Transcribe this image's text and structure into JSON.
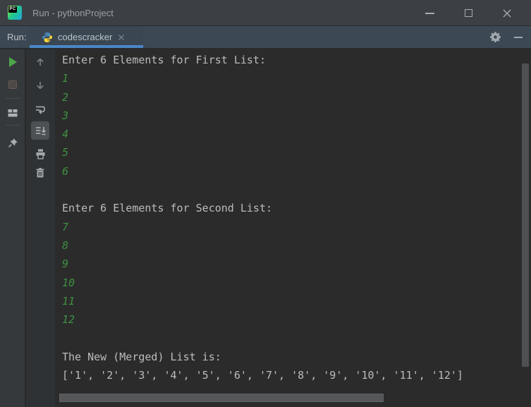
{
  "titlebar": {
    "title": "Run - pythonProject",
    "logo_text": "PC",
    "window_controls": [
      "minimize",
      "maximize",
      "close"
    ]
  },
  "runbar": {
    "label": "Run:",
    "tab": {
      "label": "codescracker",
      "icon": "python-icon",
      "close_icon": "close-icon",
      "selected": true
    },
    "right_icons": [
      "settings-gear-icon",
      "hide-window-icon"
    ]
  },
  "toolbar_left": [
    "rerun-button",
    "stop-button",
    "restore-layout-button",
    "pin-tab-button"
  ],
  "toolbar_console": [
    "up-stack-trace-button",
    "down-stack-trace-button",
    "soft-wrap-button",
    "scroll-to-end-button",
    "print-button",
    "clear-all-button"
  ],
  "toolbar_state": {
    "scroll_to_end_selected": true,
    "stop_disabled": true
  },
  "console": {
    "lines": [
      {
        "text": "Enter 6 Elements for First List:",
        "kind": "stdout"
      },
      {
        "text": "1",
        "kind": "stdin"
      },
      {
        "text": "2",
        "kind": "stdin"
      },
      {
        "text": "3",
        "kind": "stdin"
      },
      {
        "text": "4",
        "kind": "stdin"
      },
      {
        "text": "5",
        "kind": "stdin"
      },
      {
        "text": "6",
        "kind": "stdin"
      },
      {
        "text": "",
        "kind": "blank"
      },
      {
        "text": "Enter 6 Elements for Second List:",
        "kind": "stdout"
      },
      {
        "text": "7",
        "kind": "stdin"
      },
      {
        "text": "8",
        "kind": "stdin"
      },
      {
        "text": "9",
        "kind": "stdin"
      },
      {
        "text": "10",
        "kind": "stdin"
      },
      {
        "text": "11",
        "kind": "stdin"
      },
      {
        "text": "12",
        "kind": "stdin"
      },
      {
        "text": "",
        "kind": "blank"
      },
      {
        "text": "The New (Merged) List is:",
        "kind": "stdout"
      },
      {
        "text": "['1', '2', '3', '4', '5', '6', '7', '8', '9', '10', '11', '12']",
        "kind": "stdout"
      }
    ]
  },
  "colors": {
    "tab_underline_accent": "#4a88c7",
    "stdout_text": "#bcbcbc",
    "stdin_text": "#3e9141",
    "run_green": "#4CA64C",
    "console_background": "#2b2b2b",
    "titlebar_background": "#3c4045",
    "runbar_background": "#3c4854"
  }
}
